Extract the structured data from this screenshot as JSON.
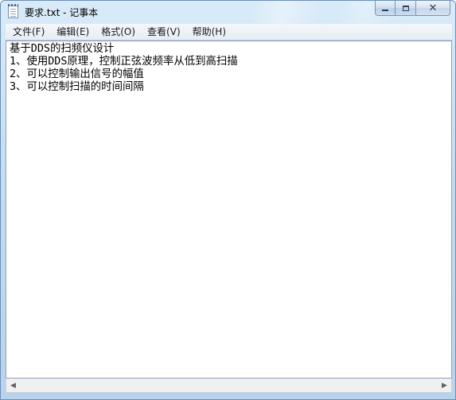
{
  "window": {
    "title": "要求.txt - 记事本",
    "app_icon": "notepad-icon"
  },
  "caption_buttons": {
    "minimize_icon": "minimize-icon",
    "maximize_icon": "maximize-icon",
    "close_icon": "close-icon",
    "close_glyph": "✕"
  },
  "menu": {
    "items": [
      {
        "label": "文件(F)"
      },
      {
        "label": "编辑(E)"
      },
      {
        "label": "格式(O)"
      },
      {
        "label": "查看(V)"
      },
      {
        "label": "帮助(H)"
      }
    ]
  },
  "document": {
    "lines": [
      "基于DDS的扫频仪设计",
      "1、使用DDS原理，控制正弦波频率从低到高扫描",
      "2、可以控制输出信号的幅值",
      "3、可以控制扫描的时间间隔"
    ]
  },
  "scrollbar": {
    "left_arrow": "◀",
    "right_arrow": "▶"
  }
}
